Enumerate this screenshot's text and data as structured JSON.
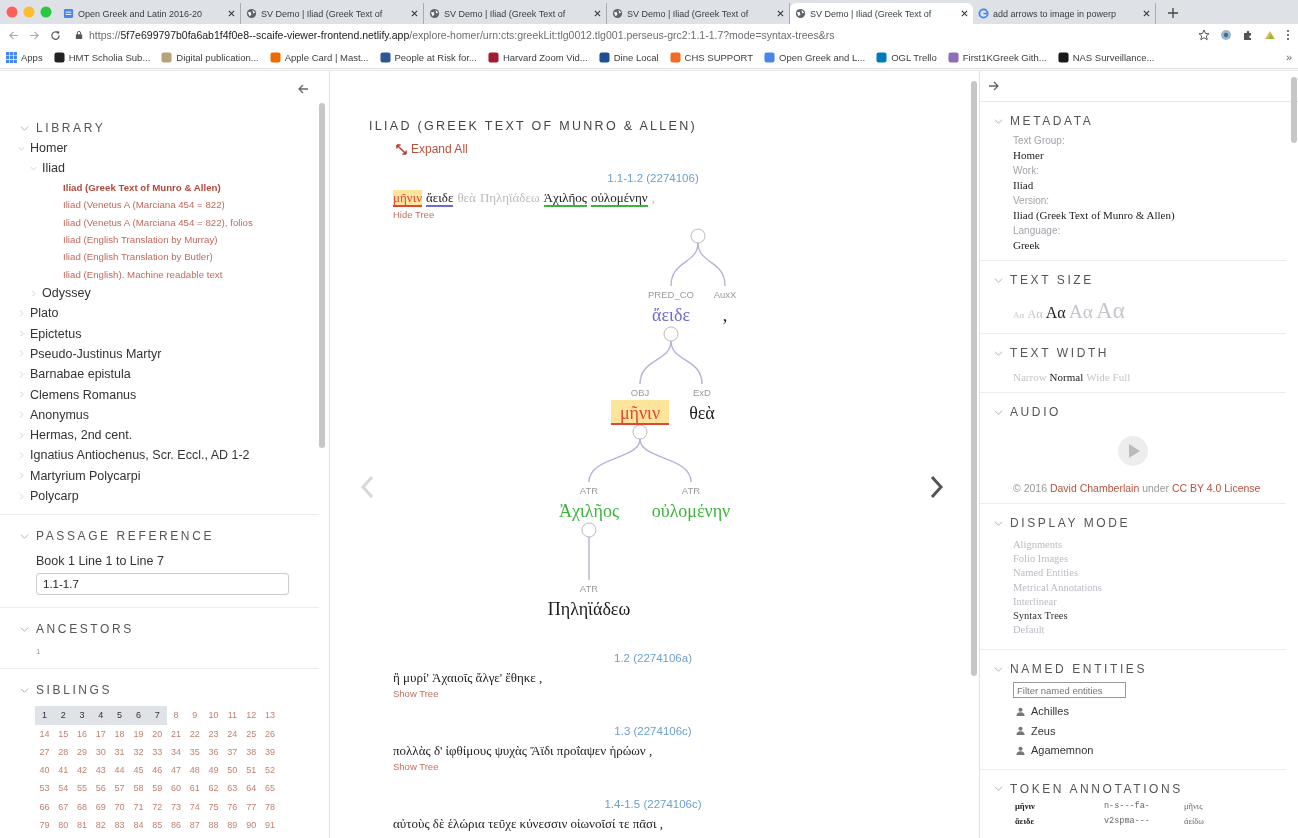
{
  "browser": {
    "tabs": [
      {
        "title": "Open Greek and Latin 2016-20",
        "kind": "doc",
        "selected": false
      },
      {
        "title": "SV Demo | Iliad (Greek Text of",
        "kind": "globe",
        "selected": false
      },
      {
        "title": "SV Demo | Iliad (Greek Text of",
        "kind": "globe",
        "selected": false
      },
      {
        "title": "SV Demo | Iliad (Greek Text of",
        "kind": "globe",
        "selected": false
      },
      {
        "title": "SV Demo | Iliad (Greek Text of",
        "kind": "globe",
        "selected": true
      },
      {
        "title": "add arrows to image in powerp",
        "kind": "search",
        "selected": false
      }
    ],
    "url": {
      "scheme": "https://",
      "host": "5f7e699797b0fa6ab1f4f0e8--scaife-viewer-frontend.netlify.app",
      "path": "/explore-homer/urn:cts:greekLit:tlg0012.tlg001.perseus-grc2:1.1-1.7?mode=syntax-trees&rs"
    },
    "bookmarks": [
      {
        "label": "Apps",
        "kind": "apps",
        "color": "#4285f4"
      },
      {
        "label": "HMT Scholia Sub...",
        "kind": "site",
        "color": "#222222"
      },
      {
        "label": "Digital publication...",
        "kind": "site",
        "color": "#b8a27a"
      },
      {
        "label": "Apple Card | Mast...",
        "kind": "site",
        "color": "#eb6b00"
      },
      {
        "label": "People at Risk for...",
        "kind": "site",
        "color": "#2f5597"
      },
      {
        "label": "Harvard Zoom Vid...",
        "kind": "site",
        "color": "#a51c30"
      },
      {
        "label": "Dine Local",
        "kind": "site",
        "color": "#1f4e99"
      },
      {
        "label": "CHS SUPPORT",
        "kind": "site",
        "color": "#f26b21"
      },
      {
        "label": "Open Greek and L...",
        "kind": "site",
        "color": "#4a86e8"
      },
      {
        "label": "OGL Trello",
        "kind": "site",
        "color": "#0079bf"
      },
      {
        "label": "First1KGreek Gith...",
        "kind": "site",
        "color": "#8e6fb5"
      },
      {
        "label": "NAS Surveillance...",
        "kind": "site",
        "color": "#1a1a1a"
      }
    ],
    "more_bookmarks": "»"
  },
  "left": {
    "library": {
      "title": "LIBRARY",
      "expanded": true,
      "items": [
        {
          "label": "Homer",
          "kind": "group",
          "expanded": true,
          "children": [
            {
              "label": "Iliad",
              "kind": "group",
              "expanded": true,
              "children": [
                {
                  "label": "Iliad (Greek Text of Munro & Allen)",
                  "kind": "version",
                  "selected": true
                },
                {
                  "label": "Iliad (Venetus A (Marciana 454 = 822)",
                  "kind": "version",
                  "selected": false
                },
                {
                  "label": "Iliad (Venetus A (Marciana 454 = 822), folios",
                  "kind": "version",
                  "selected": false
                },
                {
                  "label": "Iliad (English Translation by Murray)",
                  "kind": "version",
                  "selected": false
                },
                {
                  "label": "Iliad (English Translation by Butler)",
                  "kind": "version",
                  "selected": false
                },
                {
                  "label": "Iliad (English). Machine readable text",
                  "kind": "version",
                  "selected": false
                }
              ]
            },
            {
              "label": "Odyssey",
              "kind": "group",
              "expanded": false
            }
          ]
        },
        {
          "label": "Plato",
          "kind": "group",
          "expanded": false
        },
        {
          "label": "Epictetus",
          "kind": "group",
          "expanded": false
        },
        {
          "label": "Pseudo-Justinus Martyr",
          "kind": "group",
          "expanded": false
        },
        {
          "label": "Barnabae epistula",
          "kind": "group",
          "expanded": false
        },
        {
          "label": "Clemens Romanus",
          "kind": "group",
          "expanded": false
        },
        {
          "label": "Anonymus",
          "kind": "group",
          "expanded": false
        },
        {
          "label": "Hermas, 2nd cent.",
          "kind": "group",
          "expanded": false
        },
        {
          "label": "Ignatius Antiochenus, Scr. Eccl., AD 1-2",
          "kind": "group",
          "expanded": false
        },
        {
          "label": "Martyrium Polycarpi",
          "kind": "group",
          "expanded": false
        },
        {
          "label": "Polycarp",
          "kind": "group",
          "expanded": false
        }
      ]
    },
    "passage_reference": {
      "title": "PASSAGE REFERENCE",
      "expanded": true,
      "label": "Book 1 Line 1 to Line 7",
      "value": "1.1-1.7"
    },
    "ancestors": {
      "title": "ANCESTORS",
      "expanded": true,
      "items": [
        "1"
      ]
    },
    "siblings": {
      "title": "SIBLINGS",
      "expanded": true,
      "items": [
        {
          "label": "1",
          "selected": true
        },
        {
          "label": "2",
          "selected": true
        },
        {
          "label": "3",
          "selected": true
        },
        {
          "label": "4",
          "selected": true
        },
        {
          "label": "5",
          "selected": true
        },
        {
          "label": "6",
          "selected": true
        },
        {
          "label": "7",
          "selected": true
        },
        {
          "label": "8",
          "selected": false
        },
        {
          "label": "9",
          "selected": false
        },
        {
          "label": "10",
          "selected": false
        },
        {
          "label": "11",
          "selected": false
        },
        {
          "label": "12",
          "selected": false
        },
        {
          "label": "13",
          "selected": false
        },
        {
          "label": "14",
          "selected": false
        },
        {
          "label": "15",
          "selected": false
        },
        {
          "label": "16",
          "selected": false
        },
        {
          "label": "17",
          "selected": false
        },
        {
          "label": "18",
          "selected": false
        },
        {
          "label": "19",
          "selected": false
        },
        {
          "label": "20",
          "selected": false
        },
        {
          "label": "21",
          "selected": false
        },
        {
          "label": "22",
          "selected": false
        },
        {
          "label": "23",
          "selected": false
        },
        {
          "label": "24",
          "selected": false
        },
        {
          "label": "25",
          "selected": false
        },
        {
          "label": "26",
          "selected": false
        },
        {
          "label": "27",
          "selected": false
        },
        {
          "label": "28",
          "selected": false
        },
        {
          "label": "29",
          "selected": false
        },
        {
          "label": "30",
          "selected": false
        },
        {
          "label": "31",
          "selected": false
        },
        {
          "label": "32",
          "selected": false
        },
        {
          "label": "33",
          "selected": false
        },
        {
          "label": "34",
          "selected": false
        },
        {
          "label": "35",
          "selected": false
        },
        {
          "label": "36",
          "selected": false
        },
        {
          "label": "37",
          "selected": false
        },
        {
          "label": "38",
          "selected": false
        },
        {
          "label": "39",
          "selected": false
        },
        {
          "label": "40",
          "selected": false
        },
        {
          "label": "41",
          "selected": false
        },
        {
          "label": "42",
          "selected": false
        },
        {
          "label": "43",
          "selected": false
        },
        {
          "label": "44",
          "selected": false
        },
        {
          "label": "45",
          "selected": false
        },
        {
          "label": "46",
          "selected": false
        },
        {
          "label": "47",
          "selected": false
        },
        {
          "label": "48",
          "selected": false
        },
        {
          "label": "49",
          "selected": false
        },
        {
          "label": "50",
          "selected": false
        },
        {
          "label": "51",
          "selected": false
        },
        {
          "label": "52",
          "selected": false
        },
        {
          "label": "53",
          "selected": false
        },
        {
          "label": "54",
          "selected": false
        },
        {
          "label": "55",
          "selected": false
        },
        {
          "label": "56",
          "selected": false
        },
        {
          "label": "57",
          "selected": false
        },
        {
          "label": "58",
          "selected": false
        },
        {
          "label": "59",
          "selected": false
        },
        {
          "label": "60",
          "selected": false
        },
        {
          "label": "61",
          "selected": false
        },
        {
          "label": "62",
          "selected": false
        },
        {
          "label": "63",
          "selected": false
        },
        {
          "label": "64",
          "selected": false
        },
        {
          "label": "65",
          "selected": false
        },
        {
          "label": "66",
          "selected": false
        },
        {
          "label": "67",
          "selected": false
        },
        {
          "label": "68",
          "selected": false
        },
        {
          "label": "69",
          "selected": false
        },
        {
          "label": "70",
          "selected": false
        },
        {
          "label": "71",
          "selected": false
        },
        {
          "label": "72",
          "selected": false
        },
        {
          "label": "73",
          "selected": false
        },
        {
          "label": "74",
          "selected": false
        },
        {
          "label": "75",
          "selected": false
        },
        {
          "label": "76",
          "selected": false
        },
        {
          "label": "77",
          "selected": false
        },
        {
          "label": "78",
          "selected": false
        },
        {
          "label": "79",
          "selected": false
        },
        {
          "label": "80",
          "selected": false
        },
        {
          "label": "81",
          "selected": false
        },
        {
          "label": "82",
          "selected": false
        },
        {
          "label": "83",
          "selected": false
        },
        {
          "label": "84",
          "selected": false
        },
        {
          "label": "85",
          "selected": false
        },
        {
          "label": "86",
          "selected": false
        },
        {
          "label": "87",
          "selected": false
        },
        {
          "label": "88",
          "selected": false
        },
        {
          "label": "89",
          "selected": false
        },
        {
          "label": "90",
          "selected": false
        },
        {
          "label": "91",
          "selected": false
        }
      ]
    }
  },
  "reader": {
    "title": "ILIAD (GREEK TEXT OF MUNRO & ALLEN)",
    "expand_all": "Expand All",
    "pager": {
      "previous_disabled": true,
      "next_disabled": false
    },
    "passages": [
      {
        "reference": "1.1-1.2 (2274106)",
        "toggle": "Hide Tree",
        "tokens": [
          {
            "text": "μῆνιν",
            "color": "#e0463a",
            "highlighted": true,
            "dim": false
          },
          {
            "text": "ἄειδε",
            "color": "#6b6bd6",
            "highlighted": false,
            "dim": false
          },
          {
            "text": "θεὰ",
            "highlighted": false,
            "dim": true
          },
          {
            "text": "Πηληϊάδεω",
            "highlighted": false,
            "dim": true
          },
          {
            "text": "Ἀχιλῆος",
            "color": "#3cb43c",
            "highlighted": false,
            "dim": false
          },
          {
            "text": "οὐλομένην",
            "color": "#3cb43c",
            "highlighted": false,
            "dim": false
          },
          {
            "text": ",",
            "highlighted": false,
            "dim": true
          }
        ],
        "tree": {
          "children": [
            {
              "relation": "PRED_CO",
              "word": "ἄειδε",
              "color": "#6b6bd6",
              "highlighted": false,
              "children": [
                {
                  "relation": "OBJ",
                  "word": "μῆνιν",
                  "color": "#e0463a",
                  "highlighted": true,
                  "children": [
                    {
                      "relation": "ATR",
                      "word": "Ἀχιλῆος",
                      "color": "#3cb43c",
                      "highlighted": false,
                      "children": [
                        {
                          "relation": "ATR",
                          "word": "Πηληϊάδεω",
                          "highlighted": false
                        }
                      ]
                    },
                    {
                      "relation": "ATR",
                      "word": "οὐλομένην",
                      "color": "#3cb43c",
                      "highlighted": false
                    }
                  ]
                },
                {
                  "relation": "ExD",
                  "word": "θεὰ",
                  "highlighted": false
                }
              ]
            },
            {
              "relation": "AuxX",
              "word": ",",
              "highlighted": false
            }
          ]
        }
      },
      {
        "reference": "1.2 (2274106a)",
        "text": "ἢ μυρί' Ἀχαιοῖς ἄλγε' ἔθηκε ,",
        "toggle": "Show Tree"
      },
      {
        "reference": "1.3 (2274106c)",
        "text": "πολλὰς δ' ἰφθίμους ψυχὰς Ἄϊδι προΐαψεν ἡρώων ,",
        "toggle": "Show Tree"
      },
      {
        "reference": "1.4-1.5 (2274106c)",
        "text": "αὐτοὺς δὲ ἑλώρια τεῦχε κύνεσσιν οἰωνοῖσί τε πᾶσι ,"
      }
    ]
  },
  "right": {
    "metadata": {
      "title": "METADATA",
      "expanded": true,
      "fields": [
        {
          "label": "Text Group:",
          "value": "Homer"
        },
        {
          "label": "Work:",
          "value": "Iliad"
        },
        {
          "label": "Version:",
          "value": "Iliad (Greek Text of Munro & Allen)"
        },
        {
          "label": "Language:",
          "value": "Greek"
        }
      ]
    },
    "text_size": {
      "title": "TEXT SIZE",
      "expanded": true,
      "options": [
        {
          "label": "Aα",
          "selected": false
        },
        {
          "label": "Aα",
          "selected": false
        },
        {
          "label": "Aα",
          "selected": true
        },
        {
          "label": "Aα",
          "selected": false
        },
        {
          "label": "Aα",
          "selected": false
        }
      ]
    },
    "text_width": {
      "title": "TEXT WIDTH",
      "expanded": true,
      "options": [
        {
          "label": "Narrow",
          "selected": false
        },
        {
          "label": "Normal",
          "selected": true
        },
        {
          "label": "Wide",
          "selected": false
        },
        {
          "label": "Full",
          "selected": false
        }
      ]
    },
    "audio": {
      "title": "AUDIO",
      "expanded": true,
      "play_disabled": true,
      "credit": [
        {
          "text": "© 2016",
          "link": false
        },
        {
          "text": "David Chamberlain",
          "link": true
        },
        {
          "text": "under",
          "link": false
        },
        {
          "text": "CC BY 4.0 License",
          "link": true
        }
      ]
    },
    "display_mode": {
      "title": "DISPLAY MODE",
      "expanded": true,
      "options": [
        {
          "label": "Alignments",
          "selected": false
        },
        {
          "label": "Folio Images",
          "selected": false
        },
        {
          "label": "Named Entities",
          "selected": false
        },
        {
          "label": "Metrical Annotations",
          "selected": false
        },
        {
          "label": "Interlinear",
          "selected": false
        },
        {
          "label": "Syntax Trees",
          "selected": true
        },
        {
          "label": "Default",
          "selected": false
        }
      ]
    },
    "named_entities": {
      "title": "NAMED ENTITIES",
      "expanded": true,
      "placeholder": "Filter named entities",
      "items": [
        "Achilles",
        "Zeus",
        "Agamemnon"
      ]
    },
    "token_annotations": {
      "title": "TOKEN ANNOTATIONS",
      "expanded": true,
      "rows": [
        {
          "word": "μῆνιν",
          "tag": "n-s---fa-",
          "lemma": "μῆνις"
        },
        {
          "word": "ἄειδε",
          "tag": "v2spma---",
          "lemma": "ἀείδω"
        }
      ]
    }
  }
}
